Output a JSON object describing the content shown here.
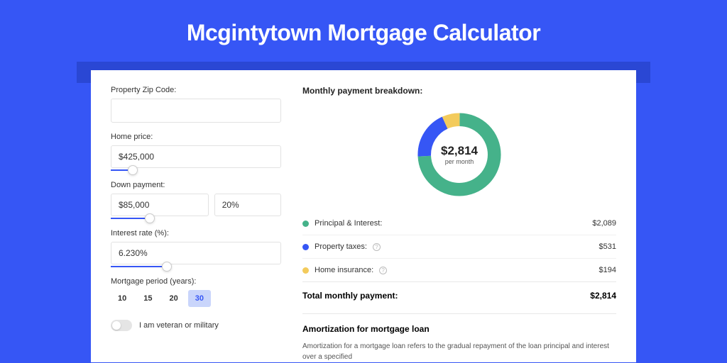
{
  "title": "Mcgintytown Mortgage Calculator",
  "form": {
    "zip_label": "Property Zip Code:",
    "zip_value": "",
    "home_price_label": "Home price:",
    "home_price_value": "$425,000",
    "down_payment_label": "Down payment:",
    "down_payment_value": "$85,000",
    "down_payment_pct": "20%",
    "interest_label": "Interest rate (%):",
    "interest_value": "6.230%",
    "period_label": "Mortgage period (years):",
    "periods": [
      "10",
      "15",
      "20",
      "30"
    ],
    "period_active_index": 3,
    "veteran_label": "I am veteran or military"
  },
  "breakdown": {
    "title": "Monthly payment breakdown:",
    "center_amount": "$2,814",
    "center_sub": "per month",
    "items": [
      {
        "label": "Principal & Interest:",
        "value": "$2,089",
        "color": "green",
        "info": false
      },
      {
        "label": "Property taxes:",
        "value": "$531",
        "color": "blue",
        "info": true
      },
      {
        "label": "Home insurance:",
        "value": "$194",
        "color": "yellow",
        "info": true
      }
    ],
    "total_label": "Total monthly payment:",
    "total_value": "$2,814"
  },
  "chart_data": {
    "type": "pie",
    "title": "Monthly payment breakdown",
    "series": [
      {
        "name": "Principal & Interest",
        "value": 2089,
        "color": "#45b28a"
      },
      {
        "name": "Property taxes",
        "value": 531,
        "color": "#3656f5"
      },
      {
        "name": "Home insurance",
        "value": 194,
        "color": "#f3cb5c"
      }
    ],
    "total": 2814,
    "center_label": "$2,814 per month"
  },
  "amortization": {
    "title": "Amortization for mortgage loan",
    "text": "Amortization for a mortgage loan refers to the gradual repayment of the loan principal and interest over a specified"
  }
}
